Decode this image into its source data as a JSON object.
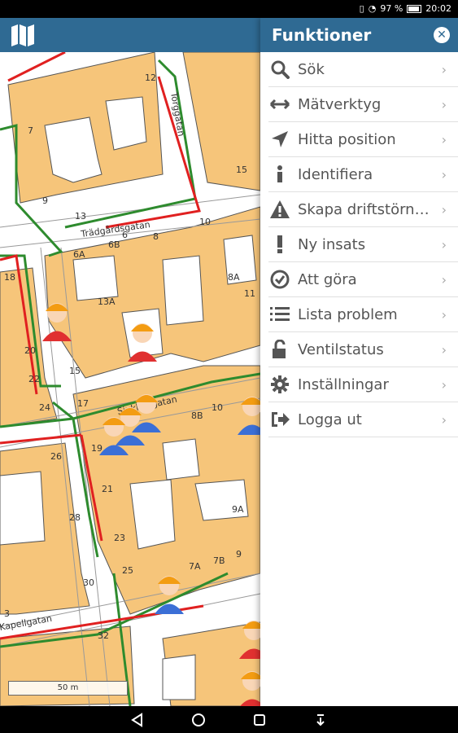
{
  "status_bar": {
    "battery": "97 %",
    "time": "20:02"
  },
  "panel": {
    "title": "Funktioner",
    "items": [
      {
        "label": "Sök",
        "icon": "search-icon"
      },
      {
        "label": "Mätverktyg",
        "icon": "measure-icon"
      },
      {
        "label": "Hitta position",
        "icon": "location-arrow-icon"
      },
      {
        "label": "Identifiera",
        "icon": "info-icon"
      },
      {
        "label": "Skapa driftstörn…",
        "icon": "warning-icon"
      },
      {
        "label": "Ny insats",
        "icon": "exclamation-icon"
      },
      {
        "label": "Att göra",
        "icon": "check-circle-icon"
      },
      {
        "label": "Lista problem",
        "icon": "list-icon"
      },
      {
        "label": "Ventilstatus",
        "icon": "unlock-icon"
      },
      {
        "label": "Inställningar",
        "icon": "gear-icon"
      },
      {
        "label": "Logga ut",
        "icon": "logout-icon"
      }
    ]
  },
  "map": {
    "scale_label": "50 m",
    "streets": [
      "Trädgårdsgatan",
      "Torggatan",
      "Sjukhusgatan",
      "Kapellgatan"
    ],
    "house_numbers": [
      "12",
      "7",
      "9",
      "13",
      "15",
      "10",
      "8",
      "6",
      "6A",
      "6B",
      "13A",
      "8A",
      "8B",
      "10",
      "15",
      "17",
      "19",
      "21",
      "23",
      "25",
      "7A",
      "7B",
      "9",
      "9A",
      "11",
      "18",
      "20",
      "22",
      "24",
      "26",
      "28",
      "30",
      "32",
      "3"
    ]
  },
  "colors": {
    "header": "#2f6a93",
    "building": "#f6c57a",
    "water_line": "#2e8b2e",
    "sewer_line": "#e02020"
  }
}
